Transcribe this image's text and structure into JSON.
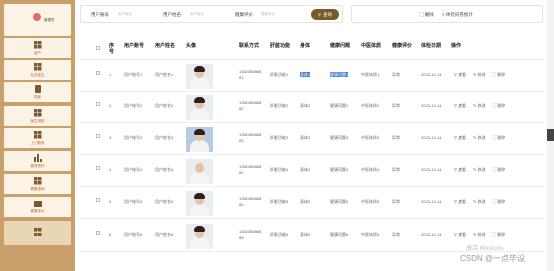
{
  "sidebar": {
    "profile_name": "管理员",
    "items": [
      {
        "label": "用户",
        "icon": "grid-icon"
      },
      {
        "label": "社区医生",
        "icon": "grid-icon"
      },
      {
        "label": "档案",
        "icon": "document-icon"
      },
      {
        "label": "医生排班",
        "icon": "grid-icon"
      },
      {
        "label": "上门服务",
        "icon": "grid-icon"
      },
      {
        "label": "服务预约",
        "icon": "bar-chart-icon"
      },
      {
        "label": "健康咨询",
        "icon": "grid-icon"
      },
      {
        "label": "健康评价",
        "icon": "folder-icon"
      },
      {
        "label": "",
        "icon": "grid-icon"
      }
    ]
  },
  "search": {
    "account_label": "用户账号",
    "account_placeholder": "用户账号",
    "name_label": "用户姓名",
    "name_placeholder": "用户姓名",
    "eval_label": "健康评价",
    "eval_placeholder": "健康评价",
    "search_button": "查询"
  },
  "toolbar": {
    "delete_button": "删除",
    "stats_button": "体检问卷统计"
  },
  "table": {
    "headers": [
      "序号",
      "用户账号",
      "用户姓名",
      "头像",
      "联系方式",
      "肝脏功能",
      "身体",
      "健康问题",
      "中医体质",
      "健康评价",
      "体检日期",
      "操作"
    ],
    "rows": [
      {
        "no": "1",
        "account": "用户账号1",
        "name": "用户姓名1",
        "phone1": "1382388888",
        "phone2": "81",
        "liver": "肝脏功能1",
        "body": "身体1",
        "issue": "健康问题1",
        "tcm": "中医体质1",
        "eval": "异常",
        "date": "2023-12-14"
      },
      {
        "no": "2",
        "account": "用户账号2",
        "name": "用户姓名2",
        "phone1": "1382388888",
        "phone2": "82",
        "liver": "肝脏功能2",
        "body": "身体2",
        "issue": "健康问题2",
        "tcm": "中医体质2",
        "eval": "异常",
        "date": "2023-12-14"
      },
      {
        "no": "3",
        "account": "用户账号3",
        "name": "用户姓名3",
        "phone1": "1382388888",
        "phone2": "83",
        "liver": "肝脏功能3",
        "body": "身体3",
        "issue": "健康问题3",
        "tcm": "中医体质3",
        "eval": "异常",
        "date": "2023-12-14"
      },
      {
        "no": "4",
        "account": "用户账号4",
        "name": "用户姓名4",
        "phone1": "1382388888",
        "phone2": "84",
        "liver": "肝脏功能4",
        "body": "身体4",
        "issue": "健康问题4",
        "tcm": "中医体质4",
        "eval": "异常",
        "date": "2023-12-14"
      },
      {
        "no": "5",
        "account": "用户账号5",
        "name": "用户姓名5",
        "phone1": "1382388888",
        "phone2": "85",
        "liver": "肝脏功能5",
        "body": "身体5",
        "issue": "健康问题5",
        "tcm": "中医体质5",
        "eval": "异常",
        "date": "2023-12-14"
      },
      {
        "no": "6",
        "account": "用户账号6",
        "name": "用户姓名6",
        "phone1": "1382388888",
        "phone2": "86",
        "liver": "肝脏功能6",
        "body": "身体6",
        "issue": "健康问题6",
        "tcm": "中医体质6",
        "eval": "异常",
        "date": "2023-12-14"
      }
    ],
    "actions": {
      "view": "查看",
      "edit": "修改",
      "delete": "删除"
    }
  },
  "watermark": {
    "activate": "激活 Windows",
    "csdn": "CSDN @一点毕设"
  },
  "colors": {
    "sidebar": "#c9a06a",
    "accent": "#7a5a2c",
    "highlight": "#3a7bd5"
  }
}
